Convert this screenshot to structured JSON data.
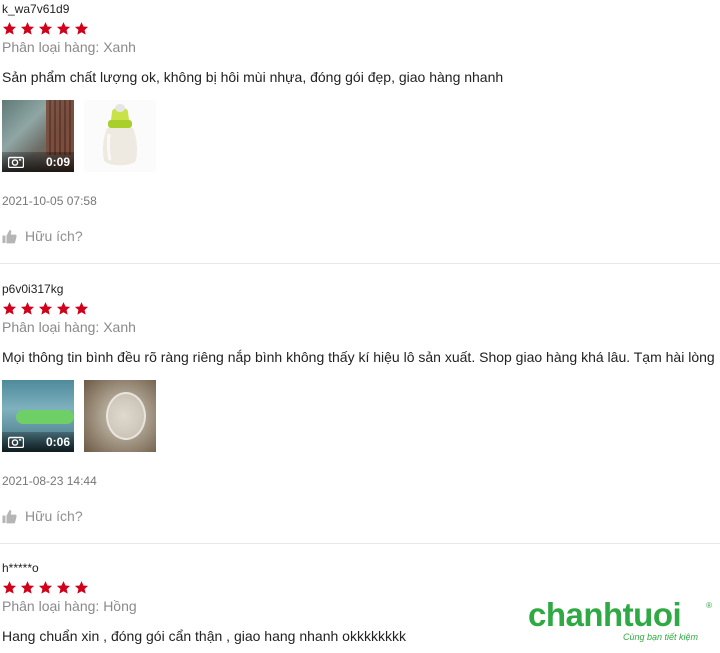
{
  "reviews": [
    {
      "username": "k_wa7v61d9",
      "rating": 5,
      "variation": "Phân loại hàng: Xanh",
      "comment": "Sản phẩm chất lượng ok, không bị hôi mùi nhựa, đóng gói đẹp, giao hàng nhanh",
      "video_duration": "0:09",
      "date": "2021-10-05 07:58",
      "helpful": "Hữu ích?"
    },
    {
      "username": "p6v0i317kg",
      "rating": 5,
      "variation": "Phân loại hàng: Xanh",
      "comment": "Mọi thông tin bình đều rõ ràng riêng nắp bình không thấy kí hiệu lô sản xuất. Shop giao hàng khá lâu. Tạm hài lòng",
      "video_duration": "0:06",
      "date": "2021-08-23 14:44",
      "helpful": "Hữu ích?"
    },
    {
      "username": "h*****o",
      "rating": 5,
      "variation": "Phân loại hàng: Hồng",
      "comment": "Hang chuẩn xin , đóng gói cẩn thận , giao hang nhanh okkkkkkkk"
    }
  ],
  "watermark": {
    "brand": "chanhtuoi",
    "registered": "®",
    "tagline": "Cùng bạn tiết kiệm"
  },
  "colors": {
    "star": "#d0011b",
    "brand_green": "#2ea944",
    "muted_text": "#8a8a8a"
  },
  "icons": [
    "star-icon",
    "video-camera-icon",
    "thumbs-up-icon"
  ]
}
